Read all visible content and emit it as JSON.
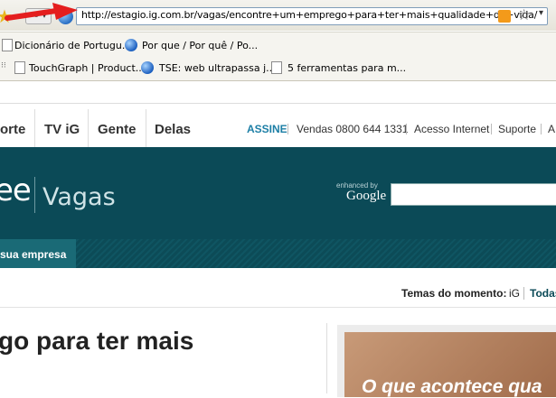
{
  "browser": {
    "url": "http://estagio.ig.com.br/vagas/encontre+um+emprego+para+ter+mais+qualidade+de+vida/",
    "bookmarks_row1": [
      "Dicionário de Portugu...",
      "Por que / Por quê / Po..."
    ],
    "bookmarks_row2": [
      "TouchGraph | Product...",
      "TSE: web ultrapassa j...",
      "5 ferramentas para m..."
    ]
  },
  "nav": {
    "links": [
      "orte",
      "TV iG",
      "Gente",
      "Delas"
    ],
    "assine": "ASSINE",
    "utility": [
      "Vendas 0800 644 1331",
      "Acesso Internet",
      "Suporte",
      "A"
    ]
  },
  "hero": {
    "brand_partial": "ee",
    "section": "Vagas",
    "enhanced_by": "enhanced by",
    "google": "Google",
    "subtab": "sua empresa"
  },
  "topics": {
    "label": "Temas do momento:",
    "first": "iG",
    "all": "Todas"
  },
  "article": {
    "headline": "go para ter mais",
    "promo": "O que acontece qua"
  },
  "colors": {
    "hero_bg": "#0b4a57",
    "assine": "#1d7fa6",
    "arrow": "#e41e1e"
  }
}
